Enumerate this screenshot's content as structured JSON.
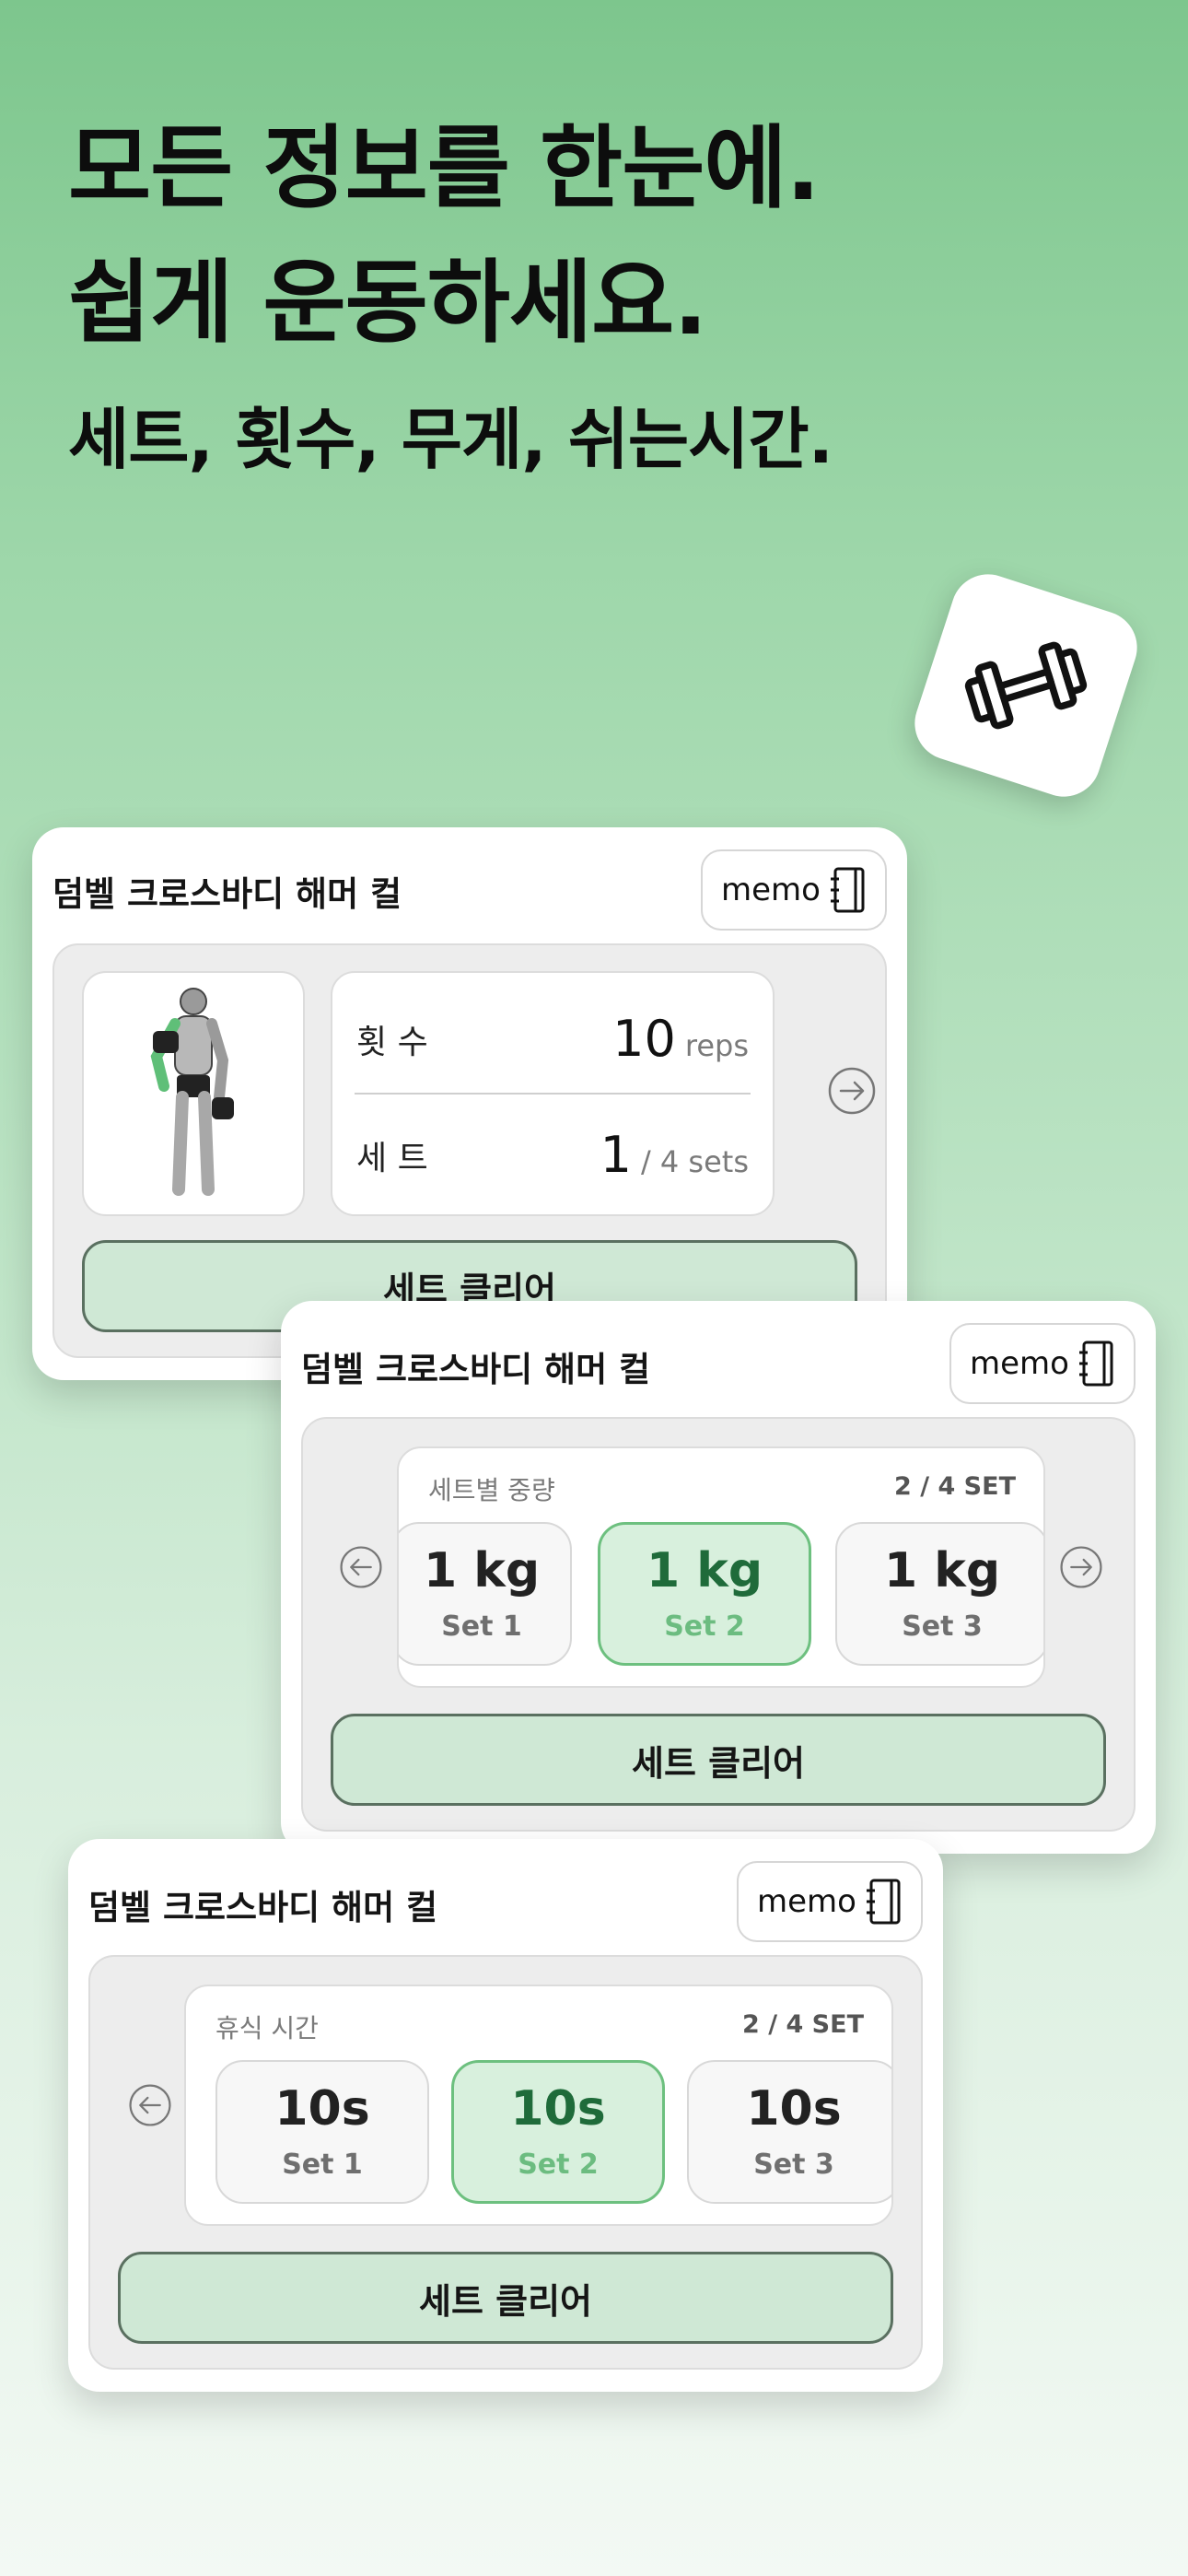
{
  "headline": {
    "line1": "모든 정보를 한눈에.",
    "line2": "쉽게 운동하세요.",
    "line3": "세트, 횟수, 무게, 쉬는시간."
  },
  "cards": [
    {
      "title": "덤벨 크로스바디 해머 컬",
      "memo_label": "memo",
      "reps_label": "횟 수",
      "reps_value": "10",
      "reps_unit": "reps",
      "sets_label": "세 트",
      "sets_value": "1",
      "sets_total": "/ 4 sets",
      "clear_label": "세트 클리어"
    },
    {
      "title": "덤벨 크로스바디 해머 컬",
      "memo_label": "memo",
      "section_label": "세트별 중량",
      "section_count": "2 / 4 SET",
      "tiles": [
        {
          "main": "1 kg",
          "sub": "Set 1"
        },
        {
          "main": "1 kg",
          "sub": "Set 2"
        },
        {
          "main": "1 kg",
          "sub": "Set 3"
        }
      ],
      "clear_label": "세트 클리어"
    },
    {
      "title": "덤벨 크로스바디 해머 컬",
      "memo_label": "memo",
      "section_label": "휴식 시간",
      "section_count": "2 / 4 SET",
      "tiles": [
        {
          "main": "10s",
          "sub": "Set 1"
        },
        {
          "main": "10s",
          "sub": "Set 2"
        },
        {
          "main": "10s",
          "sub": "Set 3"
        }
      ],
      "clear_label": "세트 클리어"
    }
  ],
  "colors": {
    "accent_green": "#6dc07f",
    "active_text": "#1f6b3a",
    "button_bg": "#cfe8d5"
  },
  "icons": [
    "dumbbell-icon",
    "notebook-icon",
    "arrow-right-circle-icon",
    "arrow-left-circle-icon"
  ]
}
